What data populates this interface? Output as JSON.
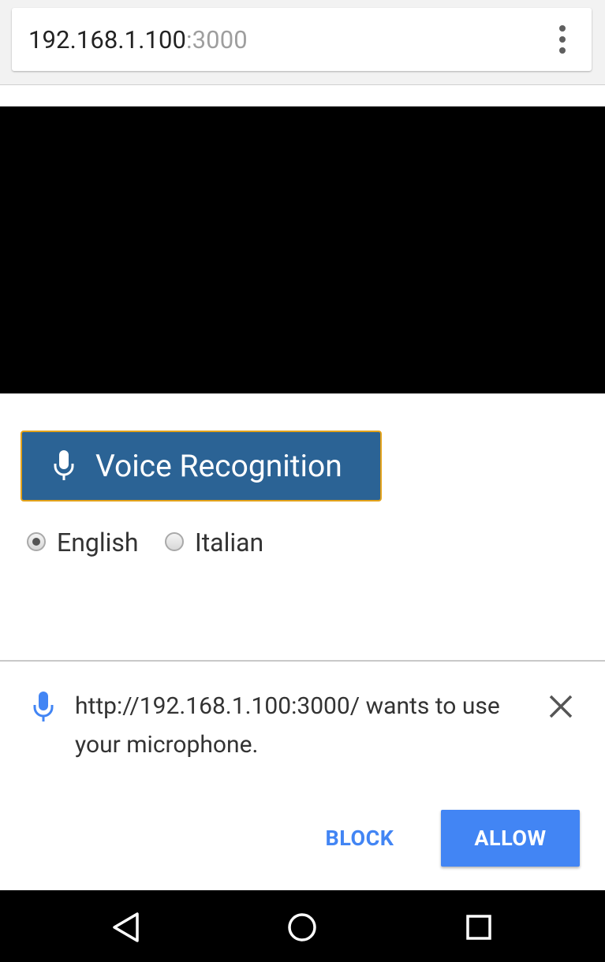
{
  "browser": {
    "url_host": "192.168.1.100",
    "url_port": ":3000",
    "menu_icon": "more-vert-icon"
  },
  "page": {
    "video_area": "video-preview",
    "voice_button": {
      "label": "Voice Recognition",
      "icon": "microphone-icon"
    },
    "languages": {
      "selected": "English",
      "options": [
        "English",
        "Italian"
      ]
    }
  },
  "permission_prompt": {
    "icon": "microphone-icon",
    "message": "http://192.168.1.100:3000/ wants to use your microphone.",
    "close_icon": "close-icon",
    "block_label": "BLOCK",
    "allow_label": "ALLOW",
    "accent_color": "#4285f4"
  },
  "colors": {
    "button_blue": "#2b6395",
    "button_focus_border": "#e3a21a",
    "allow_blue": "#4285f4"
  },
  "navigation_bar": {
    "buttons": [
      "back-icon",
      "home-icon",
      "recents-icon"
    ]
  }
}
